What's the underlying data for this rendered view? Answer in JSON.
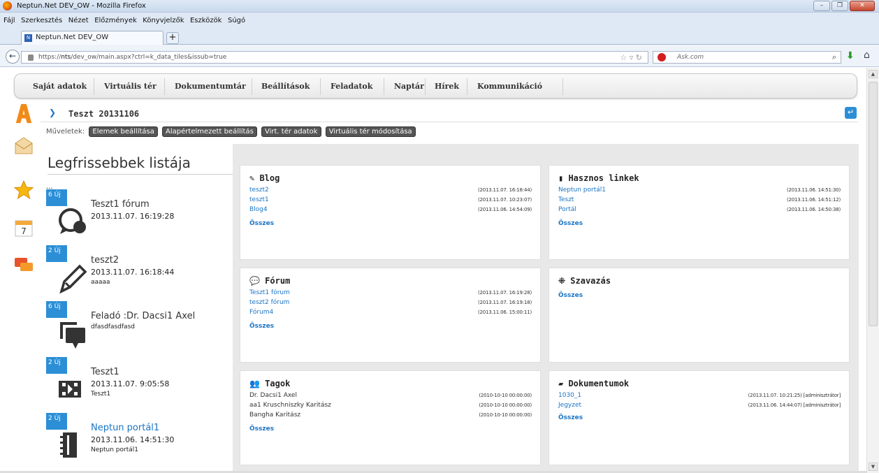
{
  "window": {
    "title": "Neptun.Net DEV_OW - Mozilla Firefox"
  },
  "menu": [
    "Fájl",
    "Szerkesztés",
    "Nézet",
    "Előzmények",
    "Könyvjelzők",
    "Eszközök",
    "Súgó"
  ],
  "tab": {
    "label": "Neptun.Net DEV_OW",
    "new_tab": "+"
  },
  "address": {
    "prefix": "https://",
    "host": "nts",
    "path": "/dev_ow/main.aspx?ctrl=k_data_tiles&issub=true"
  },
  "search": {
    "placeholder": "Ask.com"
  },
  "topnav": [
    "Saját adatok",
    "Virtuális tér",
    "Dokumentumtár",
    "Beállítások",
    "Feladatok",
    "Naptár",
    "Hírek",
    "Kommunikáció"
  ],
  "page": {
    "title": "Teszt 20131106"
  },
  "operations": {
    "label": "Műveletek:",
    "buttons": [
      "Elemek beállítása",
      "Alapértelmezett beállítás",
      "Virt. tér adatok",
      "Virtuális tér módosítása"
    ]
  },
  "feed": {
    "heading": "Legfrissebbek listája",
    "ellipsis": "...",
    "items": [
      {
        "badge": "6 Új",
        "title": "Teszt1 fórum",
        "date": "2013.11.07. 16:19:28",
        "sub": "",
        "icon": "forum-icon",
        "link": false
      },
      {
        "badge": "2 Új",
        "title": "teszt2",
        "date": "2013.11.07. 16:18:44",
        "sub": "aaaaa",
        "icon": "blog-pen-icon",
        "link": false
      },
      {
        "badge": "6 Új",
        "title": "Feladó :Dr. Dacsi1 Axel",
        "date": "",
        "sub": "dfasdfasdfasd",
        "icon": "message-icon",
        "link": false
      },
      {
        "badge": "2 Új",
        "title": "Teszt1",
        "date": "2013.11.07. 9:05:58",
        "sub": "Teszt1",
        "icon": "video-icon",
        "link": false
      },
      {
        "badge": "2 Új",
        "title": "Neptun portál1",
        "date": "2013.11.06. 14:51:30",
        "sub": "Neptun portál1",
        "icon": "notebook-icon",
        "link": true
      }
    ]
  },
  "cards": {
    "blog": {
      "title": "Blog",
      "icon": "pen-icon",
      "rows": [
        {
          "text": "teszt2",
          "time": "(2013.11.07. 16:18:44)"
        },
        {
          "text": "teszt1",
          "time": "(2013.11.07. 10:23:07)"
        },
        {
          "text": "Blog4",
          "time": "(2013.11.06. 14:54:09)"
        }
      ],
      "all": "Összes"
    },
    "links": {
      "title": "Hasznos linkek",
      "icon": "book-icon",
      "rows": [
        {
          "text": "Neptun portál1",
          "time": "(2013.11.06. 14:51:30)"
        },
        {
          "text": "Teszt",
          "time": "(2013.11.06. 14:51:12)"
        },
        {
          "text": "Portál",
          "time": "(2013.11.06. 14:50:38)"
        }
      ],
      "all": "Összes"
    },
    "forum": {
      "title": "Fórum",
      "icon": "forum-icon",
      "rows": [
        {
          "text": "Teszt1 fórum",
          "time": "(2013.11.07. 16:19:28)"
        },
        {
          "text": "teszt2 fórum",
          "time": "(2013.11.07. 16:19:18)"
        },
        {
          "text": "Fórum4",
          "time": "(2013.11.06. 15:00:11)"
        }
      ],
      "all": "Összes"
    },
    "vote": {
      "title": "Szavazás",
      "icon": "vote-icon",
      "rows": [],
      "all": "Összes"
    },
    "members": {
      "title": "Tagok",
      "icon": "members-icon",
      "rows": [
        {
          "text": "Dr. Dacsi1 Axel",
          "time": "(2010-10-10 00:00:00)"
        },
        {
          "text": "aa1 Kruschniszky Karitász",
          "time": "(2010-10-10 00:00:00)"
        },
        {
          "text": "Bangha Karitász",
          "time": "(2010-10-10 00:00:00)"
        }
      ],
      "all": "Összes"
    },
    "docs": {
      "title": "Dokumentumok",
      "icon": "folder-icon",
      "rows": [
        {
          "text": "1030_1",
          "time": "(2013.11.07. 10:21:25) [adminisztrátor]"
        },
        {
          "text": "Jegyzet",
          "time": "(2013.11.06. 14:44:07) [adminisztrátor]"
        }
      ],
      "all": "Összes"
    }
  },
  "colors": {
    "accent": "#2c8fd6",
    "link": "#1a74c4",
    "dashboard_bg": "#e8e8e8"
  }
}
